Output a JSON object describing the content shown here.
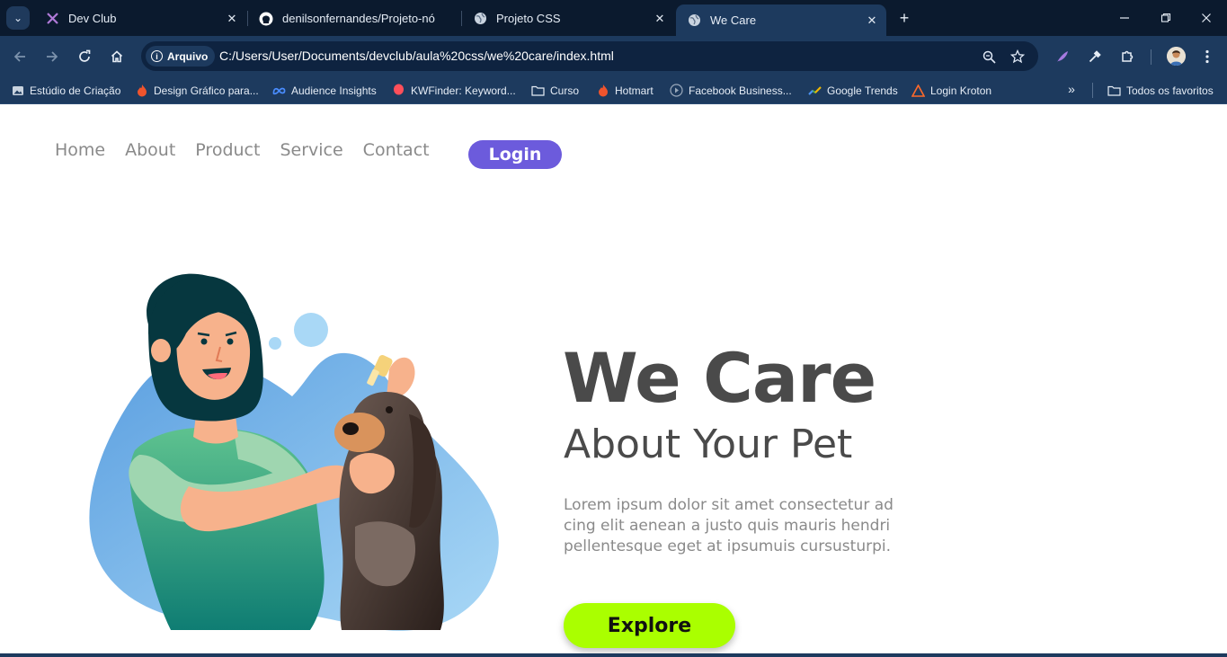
{
  "browser": {
    "tabs": [
      {
        "title": "Dev Club",
        "icon": "devclub-icon",
        "active": false
      },
      {
        "title": "denilsonfernandes/Projeto-nós",
        "icon": "github-icon",
        "active": false
      },
      {
        "title": "Projeto CSS",
        "icon": "globe-icon",
        "active": false
      },
      {
        "title": "We Care",
        "icon": "globe-icon",
        "active": true
      }
    ],
    "close_glyph": "✕",
    "new_tab_glyph": "+",
    "address": {
      "chip_label": "Arquivo",
      "url": "C:/Users/User/Documents/devclub/aula%20css/we%20care/index.html"
    },
    "bookmarks": [
      {
        "label": "Estúdio de Criação",
        "icon": "studio-icon"
      },
      {
        "label": "Design Gráfico para...",
        "icon": "flame-icon"
      },
      {
        "label": "Audience Insights",
        "icon": "meta-icon"
      },
      {
        "label": "KWFinder: Keyword...",
        "icon": "balloon-icon"
      },
      {
        "label": "Curso",
        "icon": "folder-icon"
      },
      {
        "label": "Hotmart",
        "icon": "flame-icon"
      },
      {
        "label": "Facebook Business...",
        "icon": "play-circle-icon"
      },
      {
        "label": "Google Trends",
        "icon": "trends-icon"
      },
      {
        "label": "Login Kroton",
        "icon": "kroton-icon"
      }
    ],
    "more_bookmarks_glyph": "»",
    "all_bookmarks": {
      "label": "Todos os favoritos",
      "icon": "folder-icon"
    },
    "colors": {
      "chrome": "#1d3a5e",
      "tabbar": "#0b1a2e",
      "omnibox": "#0e2340"
    }
  },
  "site": {
    "nav": [
      "Home",
      "About",
      "Product",
      "Service",
      "Contact"
    ],
    "login_label": "Login",
    "hero": {
      "title": "We Care",
      "subtitle": "About Your Pet",
      "text_lines": [
        "Lorem ipsum dolor sit amet consectetur ad",
        "cing elit aenean a justo quis mauris hendri",
        "pellentesque eget at ipsumuis cursusturpi."
      ],
      "cta_label": "Explore"
    },
    "colors": {
      "login": "#6c5bdc",
      "cta": "#aaff00",
      "heading": "#4a4a4a",
      "muted": "#8a8a8a",
      "blob": "#7fb8e8"
    }
  }
}
